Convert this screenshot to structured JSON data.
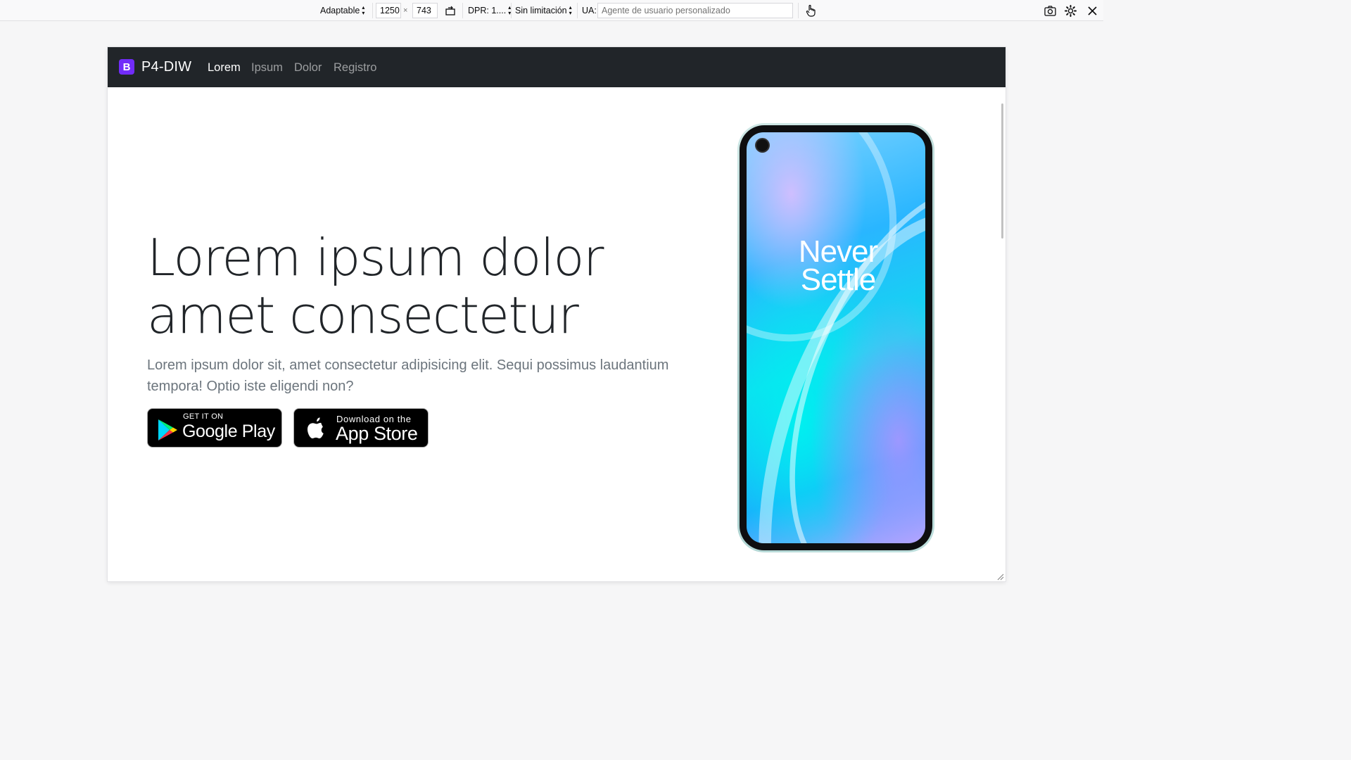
{
  "toolbar": {
    "device": "Adaptable",
    "width": "1250",
    "times": "×",
    "height": "743",
    "dpr": "DPR: 1....",
    "throttling": "Sin limitación",
    "ua_label": "UA:",
    "ua_placeholder": "Agente de usuario personalizado"
  },
  "page": {
    "brand": {
      "logo_letter": "B",
      "name": "P4-DIW"
    },
    "nav": [
      {
        "label": "Lorem",
        "active": true
      },
      {
        "label": "Ipsum",
        "active": false
      },
      {
        "label": "Dolor",
        "active": false
      },
      {
        "label": "Registro",
        "active": false
      }
    ],
    "hero": {
      "title_line1": "Lorem ipsum dolor",
      "title_line2": "amet consectetur",
      "lead_line1": "Lorem ipsum dolor sit, amet consectetur adipisicing elit. Sequi possimus laudantium",
      "lead_line2": "tempora! Optio iste eligendi non?"
    },
    "stores": {
      "google": {
        "small": "GET IT ON",
        "big": "Google Play"
      },
      "apple": {
        "small": "Download on the",
        "big": "App Store"
      }
    },
    "phone": {
      "line1": "Never",
      "line2": "Settle"
    }
  },
  "colors": {
    "navbar": "#212529",
    "brand_logo": "#712cf9",
    "title": "#212529",
    "lead": "#6c757d"
  },
  "icons": [
    "rotate-icon",
    "touch-icon",
    "screenshot-icon",
    "settings-icon",
    "close-icon",
    "play-store-icon",
    "apple-icon"
  ]
}
